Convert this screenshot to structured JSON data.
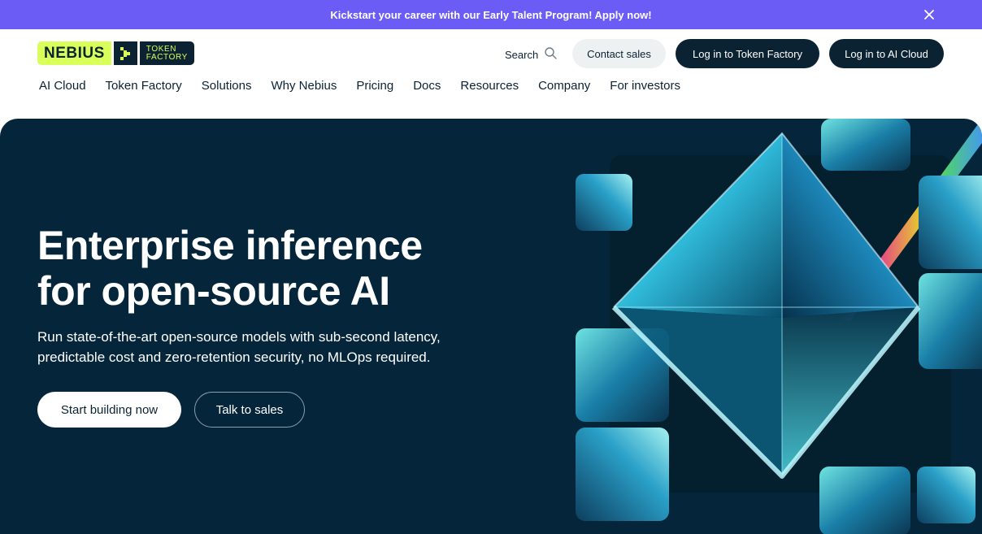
{
  "promo": {
    "text": "Kickstart your career with our Early Talent Program! Apply now!"
  },
  "logo": {
    "brand": "NEBIUS",
    "product_line1": "TOKEN",
    "product_line2": "FACTORY"
  },
  "header": {
    "search_label": "Search",
    "contact_label": "Contact sales",
    "login_token_factory": "Log in to Token Factory",
    "login_ai_cloud": "Log in to AI Cloud"
  },
  "nav": {
    "items": [
      {
        "label": "AI Cloud"
      },
      {
        "label": "Token Factory"
      },
      {
        "label": "Solutions"
      },
      {
        "label": "Why Nebius"
      },
      {
        "label": "Pricing"
      },
      {
        "label": "Docs"
      },
      {
        "label": "Resources"
      },
      {
        "label": "Company"
      },
      {
        "label": "For investors"
      }
    ]
  },
  "hero": {
    "title_line1": "Enterprise inference",
    "title_line2": "for open-source AI",
    "subtitle_line1": "Run state-of-the-art open-source models with sub-second latency,",
    "subtitle_line2": "predictable cost and zero-retention security, no MLOps required.",
    "cta_primary": "Start building now",
    "cta_secondary": "Talk to sales"
  },
  "colors": {
    "promo_bg": "#6a5cf5",
    "brand_lime": "#d8ff5a",
    "brand_dark": "#0b2233",
    "hero_bg": "#05263a"
  },
  "icons": [
    "close-icon",
    "chevron-icon",
    "search-icon",
    "prism-illustration"
  ]
}
